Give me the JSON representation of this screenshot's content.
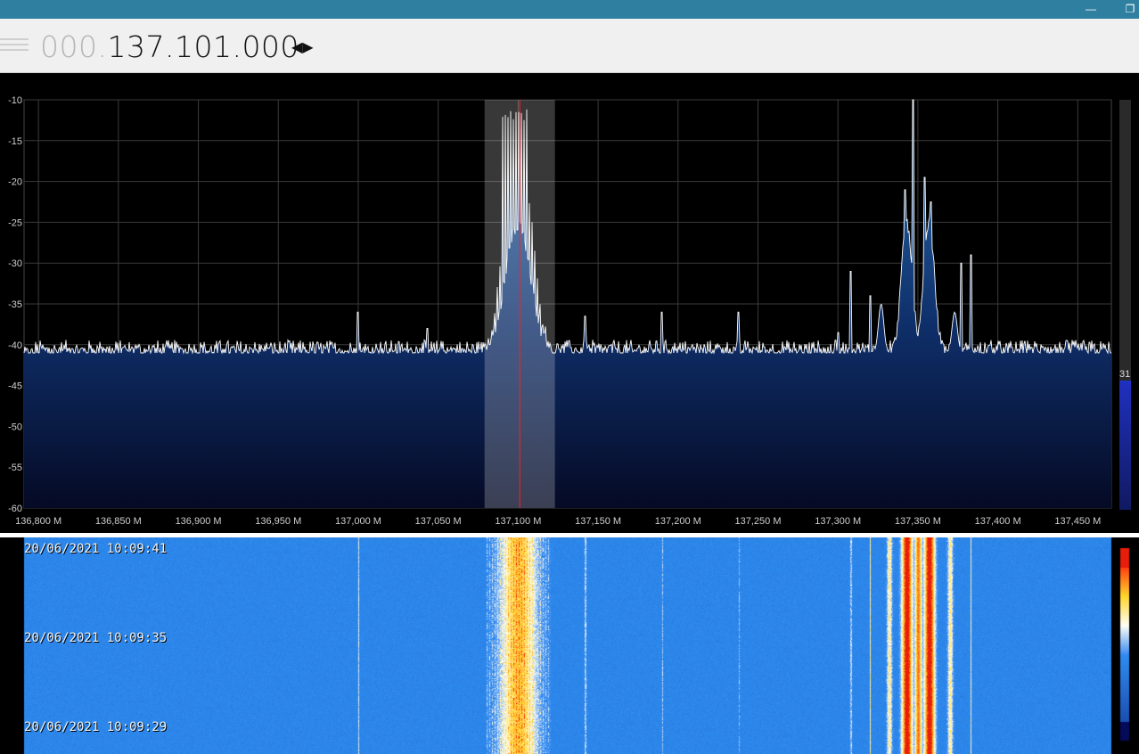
{
  "window": {
    "minimize_icon": "minimize-icon",
    "restore_icon": "restore-icon"
  },
  "frequency": {
    "dim_prefix": "000.",
    "value": "137.101.000",
    "arrows_icon": "left-right-arrows-icon"
  },
  "spectrum": {
    "y_labels": [
      "-10",
      "-15",
      "-20",
      "-25",
      "-30",
      "-35",
      "-40",
      "-45",
      "-50",
      "-55",
      "-60"
    ],
    "x_labels": [
      "136,800 M",
      "136,850 M",
      "136,900 M",
      "136,950 M",
      "137,000 M",
      "137,050 M",
      "137,100 M",
      "137,150 M",
      "137,200 M",
      "137,250 M",
      "137,300 M",
      "137,350 M",
      "137,400 M",
      "137,450 M"
    ],
    "noise_floor_db": -41,
    "filter_low_mhz": 137.079,
    "filter_high_mhz": 137.123,
    "tuned_mhz": 137.101,
    "level_indicator": "31",
    "colors": {
      "fill_top": "#2a6fb0",
      "fill_bottom": "#050a25",
      "trace": "#ffffff",
      "center_line": "#ff2020"
    }
  },
  "waterfall": {
    "timestamps": [
      "20/06/2021 10:09:41",
      "20/06/2021 10:09:35",
      "20/06/2021 10:09:29"
    ]
  }
}
